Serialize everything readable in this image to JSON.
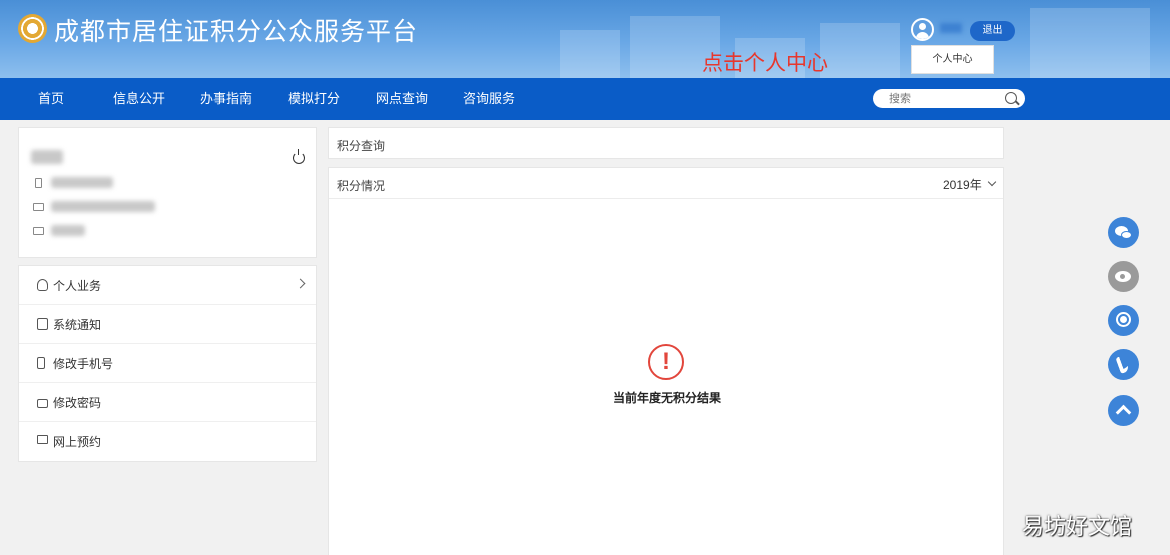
{
  "header": {
    "site_title": "成都市居住证积分公众服务平台",
    "logout_label": "退出",
    "dropdown_item": "个人中心",
    "annotation": "点击个人中心"
  },
  "nav": {
    "items": [
      "首页",
      "信息公开",
      "办事指南",
      "模拟打分",
      "网点查询",
      "咨询服务"
    ],
    "search_placeholder": "搜索"
  },
  "sidebar": {
    "menu": [
      {
        "label": "个人业务",
        "icon": "user-icon"
      },
      {
        "label": "系统通知",
        "icon": "speaker-icon"
      },
      {
        "label": "修改手机号",
        "icon": "phone-icon"
      },
      {
        "label": "修改密码",
        "icon": "lock-icon"
      },
      {
        "label": "网上预约",
        "icon": "laptop-icon"
      }
    ]
  },
  "main": {
    "query_title": "积分查询",
    "detail_title": "积分情况",
    "year": "2019年",
    "empty_message": "当前年度无积分结果"
  },
  "side_buttons": [
    "wechat-icon",
    "weibo-icon",
    "customer-service-icon",
    "phone-call-icon",
    "back-to-top-icon"
  ],
  "watermark": "易坊好文馆",
  "colors": {
    "nav_blue": "#0a5cc7",
    "accent_red": "#e2463c",
    "fab_blue": "#3d84d8"
  }
}
